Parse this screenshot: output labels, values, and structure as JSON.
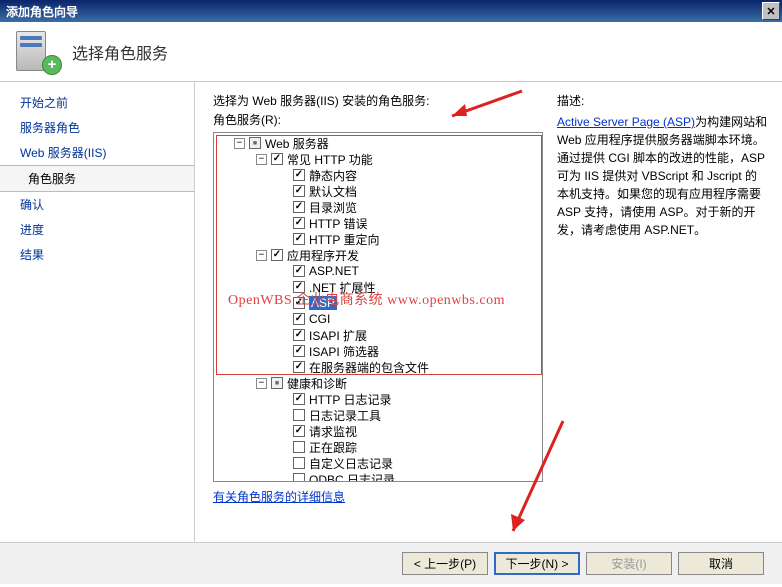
{
  "titlebar": {
    "title": "添加角色向导"
  },
  "header": {
    "title": "选择角色服务"
  },
  "sidebar": {
    "items": [
      {
        "label": "开始之前"
      },
      {
        "label": "服务器角色"
      },
      {
        "label": "Web 服务器(IIS)"
      },
      {
        "label": "角色服务",
        "active": true,
        "child": true
      },
      {
        "label": "确认"
      },
      {
        "label": "进度"
      },
      {
        "label": "结果"
      }
    ]
  },
  "main": {
    "prompt": "选择为 Web 服务器(IIS) 安装的角色服务:",
    "roles_label": "角色服务(R):",
    "detail_link": "有关角色服务的详细信息",
    "desc_title": "描述:",
    "desc_link": "Active Server Page (ASP)",
    "desc_text": "为构建网站和 Web 应用程序提供服务器端脚本环境。通过提供 CGI 脚本的改进的性能，ASP 可为 IIS 提供对 VBScript 和 Jscript 的本机支持。如果您的现有应用程序需要 ASP 支持，请使用 ASP。对于新的开发，请考虑使用 ASP.NET。"
  },
  "tree": [
    {
      "indent": 0,
      "exp": "-",
      "chk": "partial",
      "label": "Web 服务器"
    },
    {
      "indent": 1,
      "exp": "-",
      "chk": "checked",
      "label": "常见 HTTP 功能"
    },
    {
      "indent": 2,
      "chk": "checked",
      "label": "静态内容"
    },
    {
      "indent": 2,
      "chk": "checked",
      "label": "默认文档"
    },
    {
      "indent": 2,
      "chk": "checked",
      "label": "目录浏览"
    },
    {
      "indent": 2,
      "chk": "checked",
      "label": "HTTP 错误"
    },
    {
      "indent": 2,
      "chk": "checked",
      "label": "HTTP 重定向"
    },
    {
      "indent": 1,
      "exp": "-",
      "chk": "checked",
      "label": "应用程序开发"
    },
    {
      "indent": 2,
      "chk": "checked",
      "label": "ASP.NET"
    },
    {
      "indent": 2,
      "chk": "checked",
      "label": ".NET 扩展性"
    },
    {
      "indent": 2,
      "chk": "checked",
      "label": "ASP",
      "sel": true
    },
    {
      "indent": 2,
      "chk": "checked",
      "label": "CGI"
    },
    {
      "indent": 2,
      "chk": "checked",
      "label": "ISAPI 扩展"
    },
    {
      "indent": 2,
      "chk": "checked",
      "label": "ISAPI 筛选器"
    },
    {
      "indent": 2,
      "chk": "checked",
      "label": "在服务器端的包含文件"
    },
    {
      "indent": 1,
      "exp": "-",
      "chk": "partial",
      "label": "健康和诊断"
    },
    {
      "indent": 2,
      "chk": "checked",
      "label": "HTTP 日志记录"
    },
    {
      "indent": 2,
      "chk": "",
      "label": "日志记录工具"
    },
    {
      "indent": 2,
      "chk": "checked",
      "label": "请求监视"
    },
    {
      "indent": 2,
      "chk": "",
      "label": "正在跟踪"
    },
    {
      "indent": 2,
      "chk": "",
      "label": "自定义日志记录"
    },
    {
      "indent": 2,
      "chk": "",
      "label": "ODBC 日志记录"
    }
  ],
  "buttons": {
    "prev": "< 上一步(P)",
    "next": "下一步(N) >",
    "install": "安装(I)",
    "cancel": "取消"
  },
  "watermark": "OpenWBS 企业电商系统 www.openwbs.com"
}
